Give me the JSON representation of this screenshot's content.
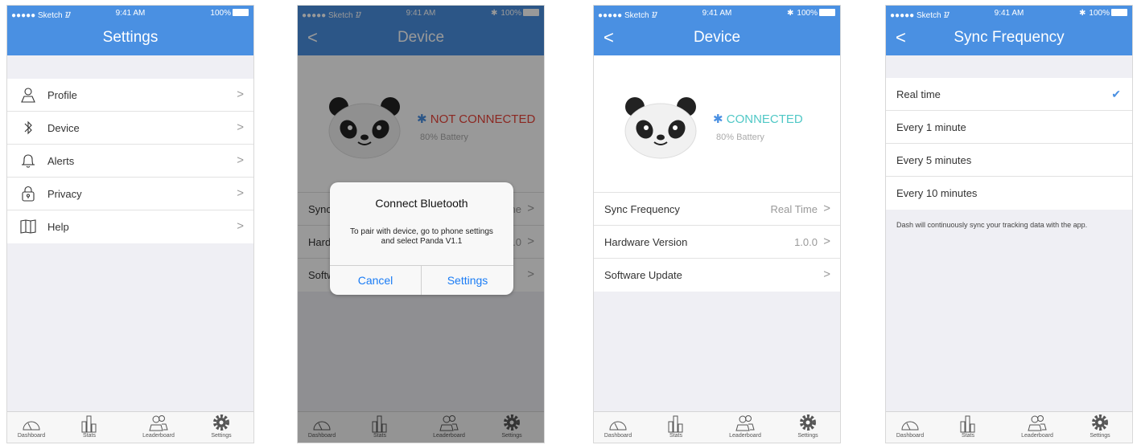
{
  "status": {
    "carrier": "●●●●● Sketch ᮻ",
    "time": "9:41 AM",
    "battery": "100%",
    "bt": "✱"
  },
  "tabs": [
    "Dashboard",
    "Stats",
    "Leaderboard",
    "Settings"
  ],
  "screen1": {
    "title": "Settings",
    "items": [
      {
        "label": "Profile",
        "icon": "user-icon"
      },
      {
        "label": "Device",
        "icon": "bluetooth-icon"
      },
      {
        "label": "Alerts",
        "icon": "bell-icon"
      },
      {
        "label": "Privacy",
        "icon": "lock-icon"
      },
      {
        "label": "Help",
        "icon": "book-icon"
      }
    ]
  },
  "screen2": {
    "title": "Device",
    "status": "NOT CONNECTED",
    "battery": "80% Battery",
    "rows_partial": [
      "Sync",
      "Hard",
      "Softw"
    ],
    "rows_right": [
      "ne",
      "0.0",
      ""
    ],
    "alert": {
      "title": "Connect Bluetooth",
      "message_line1": "To pair with device, go to phone settings",
      "message_line2": "and select Panda V1.1",
      "cancel": "Cancel",
      "settings": "Settings"
    }
  },
  "screen3": {
    "title": "Device",
    "status": "CONNECTED",
    "battery": "80% Battery",
    "rows": [
      {
        "label": "Sync Frequency",
        "value": "Real Time"
      },
      {
        "label": "Hardware Version",
        "value": "1.0.0"
      },
      {
        "label": "Software Update",
        "value": ""
      }
    ]
  },
  "screen4": {
    "title": "Sync Frequency",
    "options": [
      "Real time",
      "Every 1 minute",
      "Every 5 minutes",
      "Every 10 minutes"
    ],
    "selected": "Real time",
    "note": "Dash will continuously sync your tracking data with the app."
  },
  "colors": {
    "nav": "#4a90e2",
    "connected": "#50c8c6",
    "not_connected": "#e8443a",
    "accent": "#1a7cf5"
  }
}
